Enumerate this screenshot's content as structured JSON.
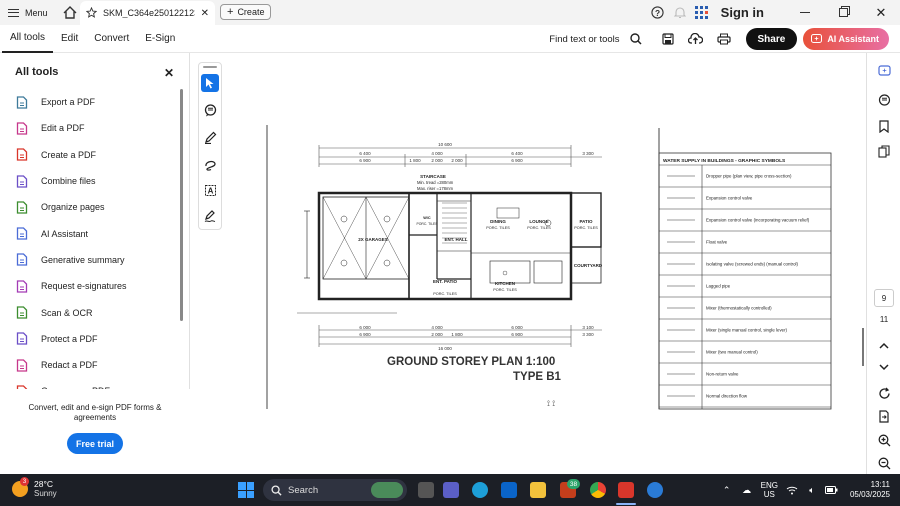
{
  "titlebar": {
    "menu_label": "Menu",
    "tab_title": "SKM_C364e2501221232...",
    "create_label": "Create",
    "signin_label": "Sign in"
  },
  "toolbar": {
    "tabs": [
      "All tools",
      "Edit",
      "Convert",
      "E-Sign"
    ],
    "find_label": "Find text or tools",
    "share_label": "Share",
    "ai_label": "AI Assistant"
  },
  "left_panel": {
    "title": "All tools",
    "items": [
      {
        "label": "Export a PDF",
        "icon": "export-pdf-icon",
        "color": "#3e7a9a"
      },
      {
        "label": "Edit a PDF",
        "icon": "edit-pdf-icon",
        "color": "#c6378b"
      },
      {
        "label": "Create a PDF",
        "icon": "create-pdf-icon",
        "color": "#d9362b"
      },
      {
        "label": "Combine files",
        "icon": "combine-files-icon",
        "color": "#6b4fc7"
      },
      {
        "label": "Organize pages",
        "icon": "organize-pages-icon",
        "color": "#3c8d2f"
      },
      {
        "label": "AI Assistant",
        "icon": "ai-assistant-icon",
        "color": "#4b6cd6"
      },
      {
        "label": "Generative summary",
        "icon": "generative-summary-icon",
        "color": "#4b6cd6"
      },
      {
        "label": "Request e-signatures",
        "icon": "request-esignatures-icon",
        "color": "#a33bb5"
      },
      {
        "label": "Scan & OCR",
        "icon": "scan-ocr-icon",
        "color": "#3c8d2f"
      },
      {
        "label": "Protect a PDF",
        "icon": "protect-pdf-icon",
        "color": "#6b4fc7"
      },
      {
        "label": "Redact a PDF",
        "icon": "redact-pdf-icon",
        "color": "#c6378b"
      },
      {
        "label": "Compress a PDF",
        "icon": "compress-pdf-icon",
        "color": "#d9362b"
      }
    ],
    "footer_text": "Convert, edit and e-sign PDF forms & agreements",
    "trial_label": "Free trial"
  },
  "document": {
    "dims_top": [
      "10 600",
      "6 400",
      "4 000",
      "6 400",
      "3 300",
      "6 900",
      "1 800",
      "2 000",
      "2 000",
      "6 900"
    ],
    "dims_bottom": [
      "6 000",
      "4 000",
      "6 000",
      "3 100",
      "3 300",
      "6 900",
      "2 000",
      "1 800",
      "6 900",
      "16 000"
    ],
    "rooms": {
      "staircase": "STAIRCASE",
      "tread": "Min. tread =280mm",
      "riser": "Max. riser =178mm",
      "garages": "2X GARAGES",
      "dining": "DINING",
      "dining_finish": "PORC. TILES",
      "lounge": "LOUNGE",
      "lounge_finish": "PORC. TILES",
      "patio": "PATIO",
      "patio_finish": "PORC. TILES",
      "entrance_hall": "ENT. HALL",
      "courtyard": "COURTYARD",
      "ent_patio": "ENT. PATIO",
      "ent_patio_finish": "PORC. TILES",
      "kitchen": "KITCHEN",
      "kitchen_finish": "PORC. TILES",
      "wc": "W/C",
      "wc_finish": "PORC. TILES"
    },
    "plan_title": "GROUND STOREY PLAN 1:100",
    "plan_type": "TYPE B1",
    "legend_title": "WATER SUPPLY IN BUILDINGS - GRAPHIC SYMBOLS",
    "legend_rows": [
      "Dropper pipe (plan view, pipe cross-section)",
      "Expansion control valve",
      "Expansion control valve (incorporating vacuum relief)",
      "Float valve",
      "Isolating valve (screwed ends) (manual control)",
      "Lagged pipe",
      "Mixer (thermostatically controlled)",
      "Mixer (single manual control, single lever)",
      "Mixer (two manual control)",
      "Non-return valve",
      "Normal direction flow"
    ]
  },
  "right_rail": {
    "page_current": "9",
    "page_total": "11"
  },
  "taskbar": {
    "temperature": "28°C",
    "condition": "Sunny",
    "weather_badge": "3",
    "search_placeholder": "Search",
    "chrome_badge": "38",
    "lang_top": "ENG",
    "lang_bottom": "US",
    "time": "13:11",
    "date": "05/03/2025"
  }
}
